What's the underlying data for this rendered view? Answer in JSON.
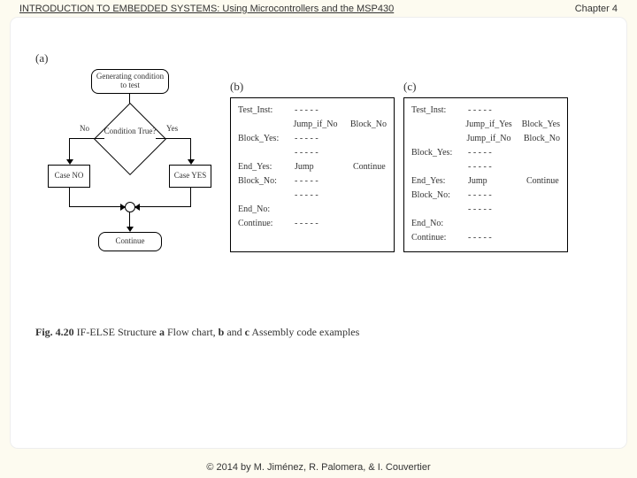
{
  "header": {
    "title": "INTRODUCTION TO EMBEDDED SYSTEMS: Using Microcontrollers and the MSP430",
    "chapter": "Chapter 4"
  },
  "labels": {
    "a": "(a)",
    "b": "(b)",
    "c": "(c)"
  },
  "flowchart": {
    "gen": "Generating condition to test",
    "cond": "Condition True?",
    "no": "No",
    "yes": "Yes",
    "case_no": "Case NO",
    "case_yes": "Case YES",
    "continue": "Continue"
  },
  "code_b": [
    {
      "label": "Test_Inst:",
      "op": "- - - - -",
      "arg": ""
    },
    {
      "label": "",
      "op": "Jump_if_No",
      "arg": "Block_No"
    },
    {
      "label": "Block_Yes:",
      "op": "- - - - -",
      "arg": ""
    },
    {
      "label": "",
      "op": "- - - - -",
      "arg": ""
    },
    {
      "label": "End_Yes:",
      "op": "Jump",
      "arg": "Continue"
    },
    {
      "label": "Block_No:",
      "op": "- - - - -",
      "arg": ""
    },
    {
      "label": "",
      "op": "- - - - -",
      "arg": ""
    },
    {
      "label": "End_No:",
      "op": "",
      "arg": ""
    },
    {
      "label": "Continue:",
      "op": "- - - - -",
      "arg": ""
    }
  ],
  "code_c": [
    {
      "label": "Test_Inst:",
      "op": "- - - - -",
      "arg": ""
    },
    {
      "label": "",
      "op": "Jump_if_Yes",
      "arg": "Block_Yes"
    },
    {
      "label": "",
      "op": "Jump_if_No",
      "arg": "Block_No"
    },
    {
      "label": "Block_Yes:",
      "op": "- - - - -",
      "arg": ""
    },
    {
      "label": "",
      "op": "- - - - -",
      "arg": ""
    },
    {
      "label": "End_Yes:",
      "op": "Jump",
      "arg": "Continue"
    },
    {
      "label": "Block_No:",
      "op": "- - - - -",
      "arg": ""
    },
    {
      "label": "",
      "op": "- - - - -",
      "arg": ""
    },
    {
      "label": "End_No:",
      "op": "",
      "arg": ""
    },
    {
      "label": "Continue:",
      "op": "- - - - -",
      "arg": ""
    }
  ],
  "caption": {
    "fig": "Fig. 4.20",
    "text1": "  IF-ELSE Structure ",
    "a": "a",
    "text2": " Flow chart, ",
    "b": "b",
    "text3": " and ",
    "c": "c",
    "text4": " Assembly code examples"
  },
  "footer": "© 2014 by M. Jiménez, R. Palomera, & I. Couvertier"
}
